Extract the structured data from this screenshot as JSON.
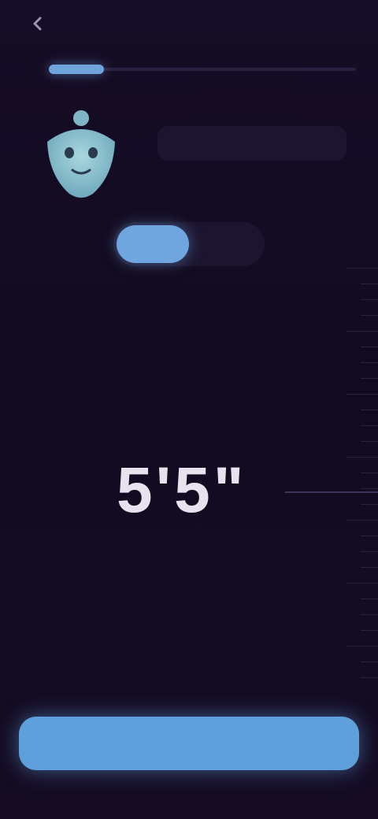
{
  "header": {
    "back_icon": "chevron-left-icon",
    "action_label": ""
  },
  "progress": {
    "fraction": 0.18
  },
  "assistant": {
    "message": ""
  },
  "unit_toggle": {
    "options": [
      "",
      ""
    ],
    "selected_index": 0
  },
  "height": {
    "value": "5'5\""
  },
  "footer": {
    "continue_label": ""
  },
  "colors": {
    "accent": "#6fa6e0",
    "background": "#140d22",
    "mascot": "#8ec3cf"
  }
}
